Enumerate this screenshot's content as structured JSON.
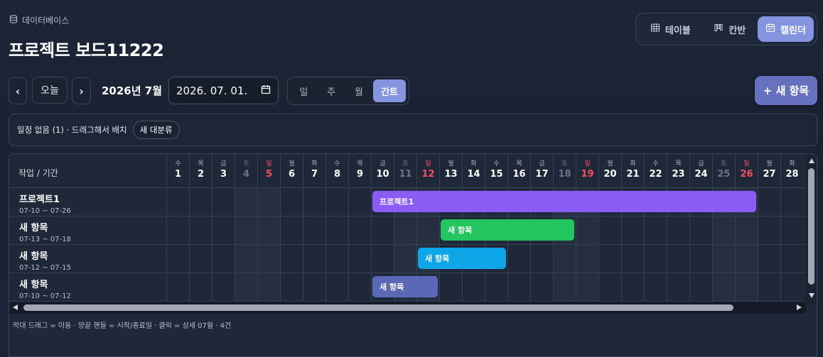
{
  "breadcrumb": "데이터베이스",
  "title": "프로젝트 보드11222",
  "views": [
    {
      "label": "테이블",
      "icon": "table-icon",
      "active": false
    },
    {
      "label": "칸반",
      "icon": "kanban-icon",
      "active": false
    },
    {
      "label": "캘린더",
      "icon": "calendar-icon",
      "active": true
    }
  ],
  "toolbar": {
    "prev": "‹",
    "today": "오늘",
    "next": "›",
    "month_label": "2026년 7월",
    "date_value": "2026. 07. 01.",
    "scales": [
      "일",
      "주",
      "월",
      "간트"
    ],
    "active_scale": "간트",
    "new_item": "+ 새 항목"
  },
  "unscheduled": {
    "text": "일정 없음 (1) · 드래그해서 배치",
    "chip": "새 대분류"
  },
  "gantt": {
    "task_header": "작업 / 기간",
    "days": [
      {
        "dow": "수",
        "num": "1"
      },
      {
        "dow": "목",
        "num": "2"
      },
      {
        "dow": "금",
        "num": "3"
      },
      {
        "dow": "토",
        "num": "4"
      },
      {
        "dow": "일",
        "num": "5"
      },
      {
        "dow": "월",
        "num": "6"
      },
      {
        "dow": "화",
        "num": "7"
      },
      {
        "dow": "수",
        "num": "8"
      },
      {
        "dow": "목",
        "num": "9"
      },
      {
        "dow": "금",
        "num": "10"
      },
      {
        "dow": "토",
        "num": "11"
      },
      {
        "dow": "일",
        "num": "12"
      },
      {
        "dow": "월",
        "num": "13"
      },
      {
        "dow": "화",
        "num": "14"
      },
      {
        "dow": "수",
        "num": "15"
      },
      {
        "dow": "목",
        "num": "16"
      },
      {
        "dow": "금",
        "num": "17"
      },
      {
        "dow": "토",
        "num": "18"
      },
      {
        "dow": "일",
        "num": "19"
      },
      {
        "dow": "월",
        "num": "20"
      },
      {
        "dow": "화",
        "num": "21"
      },
      {
        "dow": "수",
        "num": "22"
      },
      {
        "dow": "목",
        "num": "23"
      },
      {
        "dow": "금",
        "num": "24"
      },
      {
        "dow": "토",
        "num": "25"
      },
      {
        "dow": "일",
        "num": "26"
      },
      {
        "dow": "월",
        "num": "27"
      },
      {
        "dow": "화",
        "num": "28"
      }
    ],
    "rows": [
      {
        "name": "프로젝트1",
        "range": "07-10 ~ 07-26",
        "start": 10,
        "end": 26,
        "color": "#8b5cf6",
        "bar_label": "프로젝트1"
      },
      {
        "name": "새 항목",
        "range": "07-13 ~ 07-18",
        "start": 13,
        "end": 18,
        "color": "#22c55e",
        "bar_label": "새 항목"
      },
      {
        "name": "새 항목",
        "range": "07-12 ~ 07-15",
        "start": 12,
        "end": 15,
        "color": "#0ea5e9",
        "bar_label": "새 항목"
      },
      {
        "name": "새 항목",
        "range": "07-10 ~ 07-12",
        "start": 10,
        "end": 12,
        "color": "#5b68b5",
        "bar_label": "새 항목"
      }
    ],
    "footer": "막대 드래그 = 이동 · 양끝 핸들 = 시작/종료일 · 클릭 = 상세     07월 · 4건"
  }
}
